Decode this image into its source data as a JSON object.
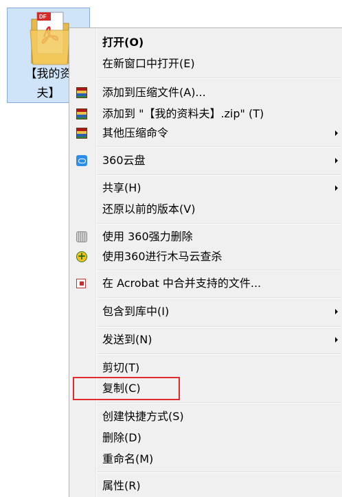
{
  "desktop_item": {
    "label_line1": "【我的资",
    "label_line2": "夫】",
    "icon": "pdf-folder-icon"
  },
  "menu": {
    "open": "打开(O)",
    "open_new_window": "在新窗口中打开(E)",
    "add_to_archive": "添加到压缩文件(A)...",
    "add_to_zip": "添加到 \"【我的资料夫】.zip\" (T)",
    "other_compress": "其他压缩命令",
    "cloud_360": "360云盘",
    "share": "共享(H)",
    "restore_versions": "还原以前的版本(V)",
    "shred_360": "使用 360强力删除",
    "scan_360": "使用360进行木马云查杀",
    "acrobat_combine": "在 Acrobat 中合并支持的文件...",
    "include_library": "包含到库中(I)",
    "send_to": "发送到(N)",
    "cut": "剪切(T)",
    "copy": "复制(C)",
    "create_shortcut": "创建快捷方式(S)",
    "delete": "删除(D)",
    "rename": "重命名(M)",
    "properties": "属性(R)"
  },
  "icons": {
    "rar": "winrar-icon",
    "cloud": "360-cloud-icon",
    "shred": "shredder-icon",
    "scan": "360-scan-icon",
    "acrobat": "acrobat-icon"
  },
  "colors": {
    "selection_bg": "#cfe4f8",
    "menu_bg": "#f0f0f0",
    "highlight_border": "#e02a2a"
  }
}
